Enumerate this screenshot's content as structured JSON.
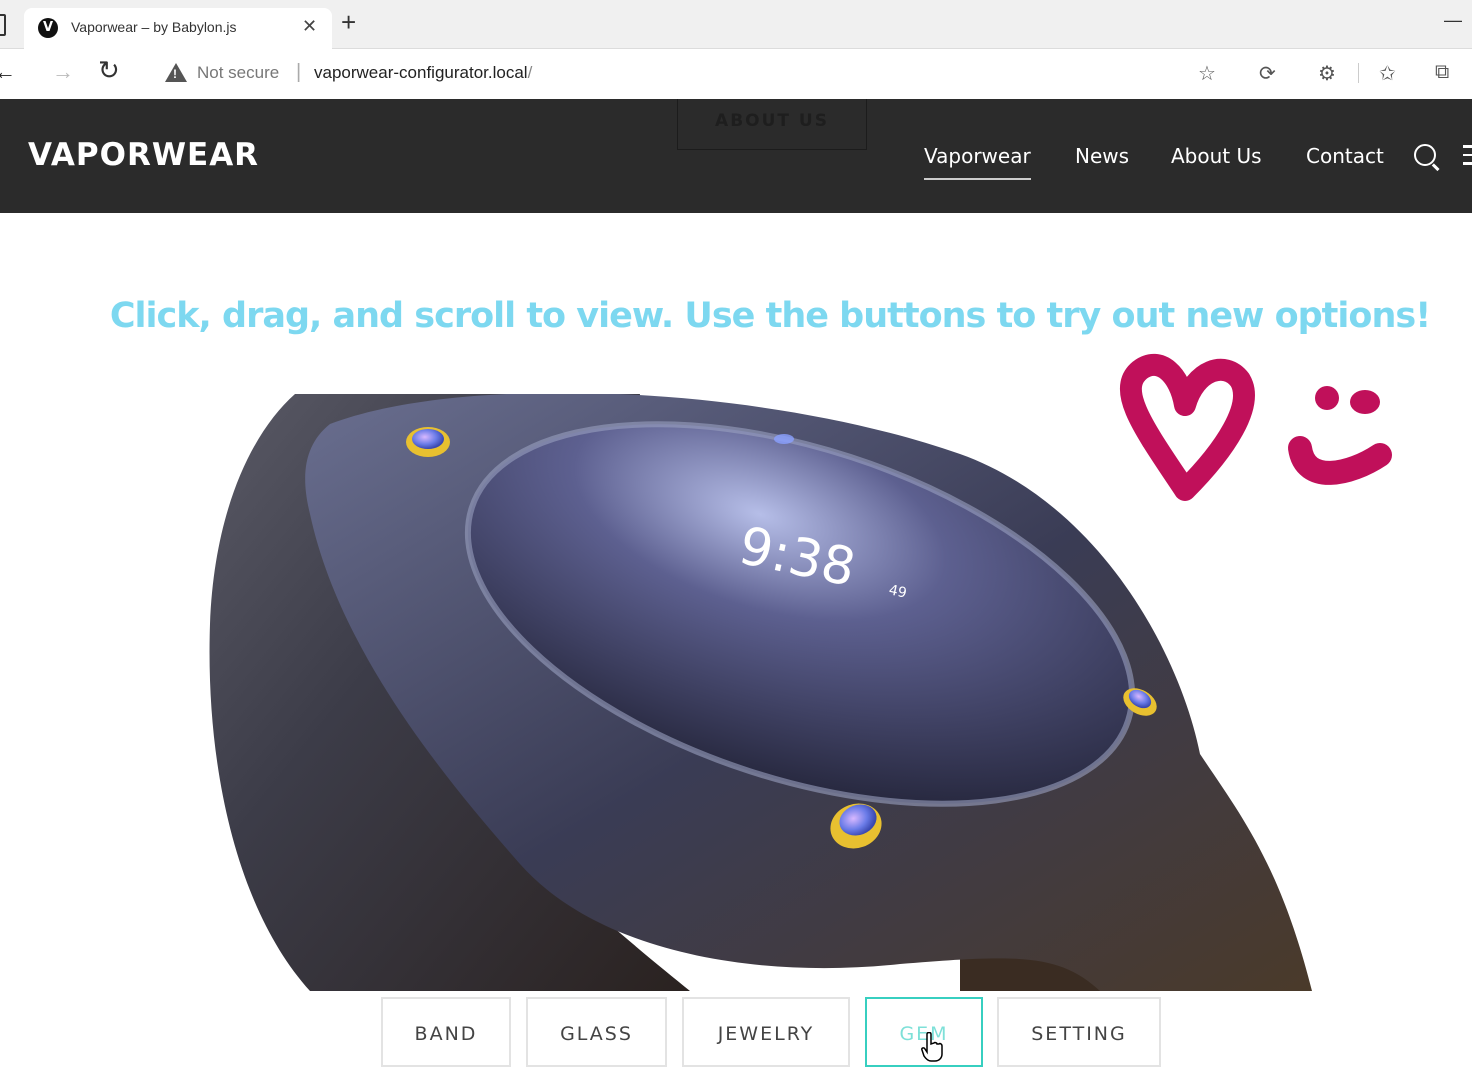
{
  "browser": {
    "tab_title": "Vaporwear – by Babylon.js",
    "tab_favicon": "V",
    "tab_close": "✕",
    "new_tab": "+",
    "security_label": "Not secure",
    "url_host": "vaporwear-configurator.local",
    "url_path": "/",
    "toolbar_icons": [
      "add-favorite-icon",
      "refresh-page-icon",
      "extensions-icon",
      "favorites-icon",
      "collections-icon"
    ]
  },
  "header": {
    "logo": "VAPORWEAR",
    "ghost_button": "ABOUT US",
    "nav": [
      "Vaporwear",
      "News",
      "About Us",
      "Contact"
    ],
    "active_nav": "Vaporwear",
    "background": "#2b2b2b"
  },
  "main": {
    "instruction": "Click, drag, and scroll to view. Use the buttons to try out new options!",
    "instruction_color": "#7dd8f0",
    "watch_time": "9:38",
    "watch_seconds": "49",
    "doodle_color": "#c0105a"
  },
  "options": {
    "buttons": [
      "BAND",
      "GLASS",
      "JEWELRY",
      "GEM",
      "SETTING"
    ],
    "selected": "GEM",
    "selected_color": "#37cfc0"
  }
}
